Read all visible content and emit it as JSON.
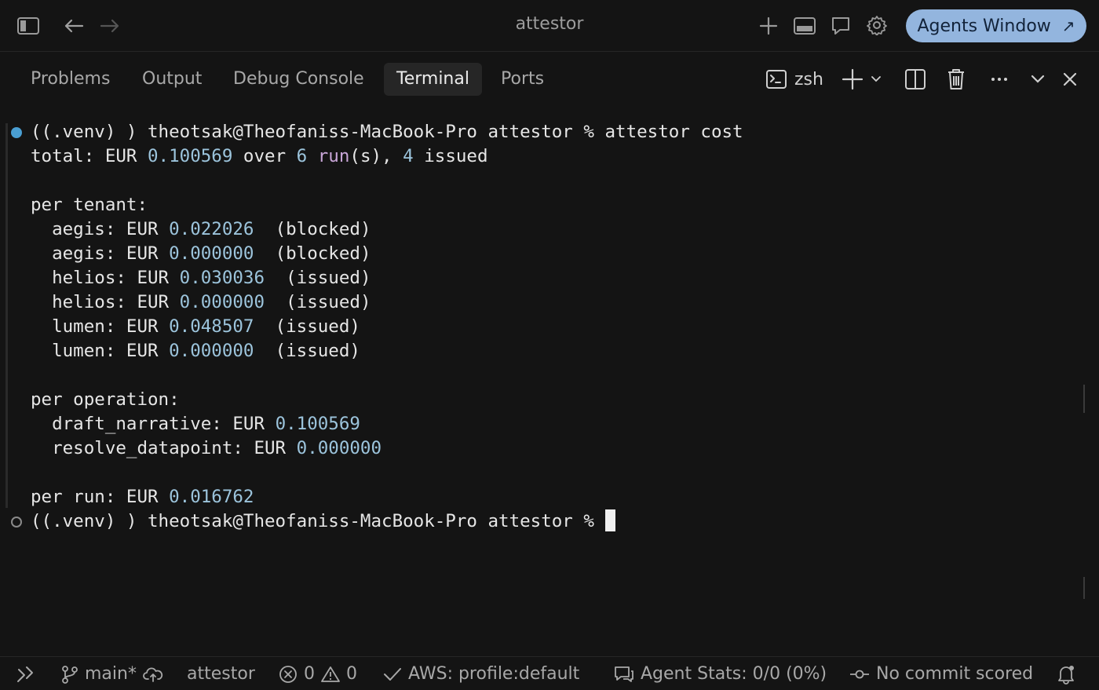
{
  "window": {
    "title": "attestor",
    "agents_button_label": "Agents Window",
    "agents_button_arrow": "↗"
  },
  "panel": {
    "tabs": [
      {
        "label": "Problems",
        "active": false
      },
      {
        "label": "Output",
        "active": false
      },
      {
        "label": "Debug Console",
        "active": false
      },
      {
        "label": "Terminal",
        "active": true
      },
      {
        "label": "Ports",
        "active": false
      }
    ],
    "terminal_name": "zsh"
  },
  "terminal": {
    "prompt_1": "((.venv) ) theotsak@Theofaniss-MacBook-Pro attestor % attestor cost",
    "total": {
      "prefix": "total: EUR ",
      "amount": "0.100569",
      "over": " over ",
      "runs": "6",
      "run_word": " run",
      "run_paren": "(s), ",
      "issued_count": "4",
      "issued_word": " issued"
    },
    "per_tenant_header": "per tenant:",
    "tenants": [
      {
        "name": "  aegis: EUR ",
        "amount": "0.022026",
        "status": "  (blocked)"
      },
      {
        "name": "  aegis: EUR ",
        "amount": "0.000000",
        "status": "  (blocked)"
      },
      {
        "name": "  helios: EUR ",
        "amount": "0.030036",
        "status": "  (issued)"
      },
      {
        "name": "  helios: EUR ",
        "amount": "0.000000",
        "status": "  (issued)"
      },
      {
        "name": "  lumen: EUR ",
        "amount": "0.048507",
        "status": "  (issued)"
      },
      {
        "name": "  lumen: EUR ",
        "amount": "0.000000",
        "status": "  (issued)"
      }
    ],
    "per_operation_header": "per operation:",
    "operations": [
      {
        "name": "  draft_narrative: EUR ",
        "amount": "0.100569"
      },
      {
        "name": "  resolve_datapoint: EUR ",
        "amount": "0.000000"
      }
    ],
    "per_run": {
      "prefix": "per run: EUR ",
      "amount": "0.016762"
    },
    "prompt_2": "((.venv) ) theotsak@Theofaniss-MacBook-Pro attestor % "
  },
  "statusbar": {
    "branch": "main*",
    "folder": "attestor",
    "errors": "0",
    "warnings": "0",
    "aws": "AWS: profile:default",
    "agent_stats": "Agent Stats: 0/0 (0%)",
    "commit": "No commit scored"
  },
  "colors": {
    "accent": "#93b5de",
    "number": "#9cc4dc",
    "decorator_dot": "#4a9fd3"
  }
}
